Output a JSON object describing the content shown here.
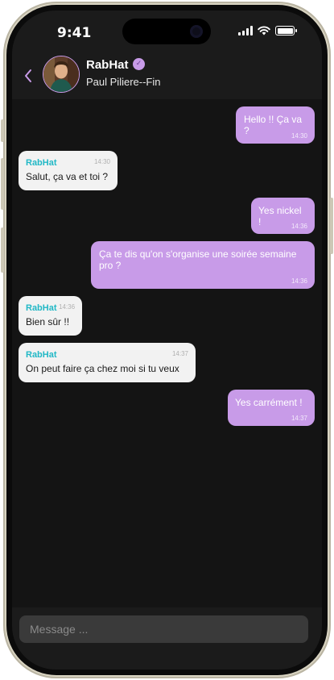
{
  "status_bar": {
    "time": "9:41"
  },
  "header": {
    "name": "RabHat",
    "subtitle": "Paul Piliere--Fin",
    "badge_icon": "verified-badge-icon"
  },
  "messages": [
    {
      "direction": "out",
      "text": "Hello !! Ça va ?",
      "time": "14:30"
    },
    {
      "direction": "in",
      "sender": "RabHat",
      "text": "Salut, ça va et toi ?",
      "time": "14:30"
    },
    {
      "direction": "out",
      "text": "Yes nickel !",
      "time": "14:36"
    },
    {
      "direction": "out",
      "text": "Ça te dis qu'on s'organise une soirée semaine pro ?",
      "time": "14:36"
    },
    {
      "direction": "in",
      "sender": "RabHat",
      "text": "Bien sûr !!",
      "time": "14:36"
    },
    {
      "direction": "in",
      "sender": "RabHat",
      "text": "On peut faire ça chez moi si tu veux",
      "time": "14:37"
    },
    {
      "direction": "out",
      "text": "Yes carrément !",
      "time": "14:37"
    }
  ],
  "composer": {
    "placeholder": "Message ..."
  },
  "colors": {
    "accent": "#c89be8",
    "sender": "#21b8c6",
    "incoming_bubble": "#f2f2f2",
    "background": "#141414"
  }
}
